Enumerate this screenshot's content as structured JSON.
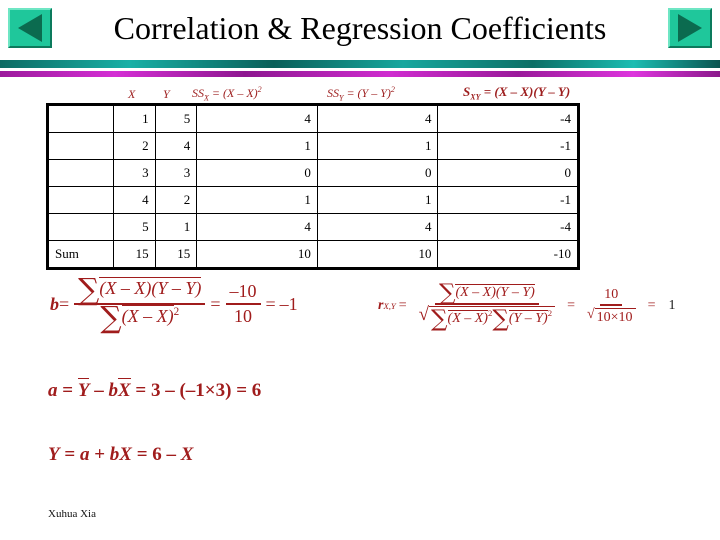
{
  "nav": {
    "prev_label": "Previous slide",
    "prev_icon": "triangle-left-icon",
    "next_label": "Next slide",
    "next_icon": "triangle-right-icon"
  },
  "title": "Correlation & Regression Coefficients",
  "colors": {
    "title_text": "#000000",
    "header_formula": "#9e2020",
    "equation_red": "#a01c1c",
    "rule_teal": "#17a79e",
    "rule_magenta": "#cf2ccf",
    "nav_button_face": "#1fc79b",
    "nav_button_arrow": "#0b6b4f"
  },
  "table": {
    "headers": {
      "label": "",
      "x": "X",
      "y": "Y",
      "ssx_lead": "SS",
      "ssx_sub": "X",
      "ssx_body": " = (X – X)",
      "ssx_sup": "2",
      "ssy_lead": "SS",
      "ssy_sub": "Y",
      "ssy_body": " = (Y – Y)",
      "ssy_sup": "2",
      "sxy_lead": "S",
      "sxy_sub": "XY",
      "sxy_body": " = (X – X)(Y – Y)"
    },
    "rows": [
      {
        "label": "",
        "x": "1",
        "y": "5",
        "ssx": "4",
        "ssy": "4",
        "sxy": "-4"
      },
      {
        "label": "",
        "x": "2",
        "y": "4",
        "ssx": "1",
        "ssy": "1",
        "sxy": "-1"
      },
      {
        "label": "",
        "x": "3",
        "y": "3",
        "ssx": "0",
        "ssy": "0",
        "sxy": "0"
      },
      {
        "label": "",
        "x": "4",
        "y": "2",
        "ssx": "1",
        "ssy": "1",
        "sxy": "-1"
      },
      {
        "label": "",
        "x": "5",
        "y": "1",
        "ssx": "4",
        "ssy": "4",
        "sxy": "-4"
      },
      {
        "label": "Sum",
        "x": "15",
        "y": "15",
        "ssx": "10",
        "ssy": "10",
        "sxy": "-10"
      }
    ]
  },
  "equations": {
    "b": {
      "lhs": "b",
      "eq1": "=",
      "num_sigma": "∑",
      "num_body": "(X – X)(Y – Y)",
      "den_sigma": "∑",
      "den_body": "(X – X)",
      "den_sup": "2",
      "eq2": "=",
      "val_num": "–10",
      "val_den": "10",
      "eq3": "=",
      "result": "–1"
    },
    "r": {
      "lhs": "r",
      "lhs_sub": "X,Y",
      "eq1": "=",
      "num_sigma": "∑",
      "num_body": "(X – X)(Y – Y)",
      "den_radical": "√",
      "den_sigma1": "∑",
      "den_body1": "(X – X)",
      "den_sup1": "2",
      "den_sigma2": "∑",
      "den_body2": "(Y – Y)",
      "den_sup2": "2",
      "eq2": "=",
      "val_num": "10",
      "val_radical": "√",
      "val_den": "10×10",
      "eq3": "=",
      "result": "1"
    },
    "a": {
      "text": "a = Y – bX = 3 – (–1×3) = 6",
      "lhs": "a",
      "eq1": "=",
      "ybar": "Y",
      "minus": "–",
      "b_sym": "b",
      "xbar": "X",
      "eq2": "=",
      "v1": "3",
      "minus2": "–",
      "paren": "(–1×3)",
      "eq3": "=",
      "result": "6"
    },
    "y": {
      "text": "Y = a + bX = 6 – X",
      "lhs": "Y",
      "eq1": "=",
      "a_sym": "a",
      "plus": "+",
      "b_sym": "b",
      "x_sym": "X",
      "eq2": "=",
      "v1": "6",
      "minus": "–",
      "x_sym2": "X"
    }
  },
  "footer": "Xuhua Xia"
}
